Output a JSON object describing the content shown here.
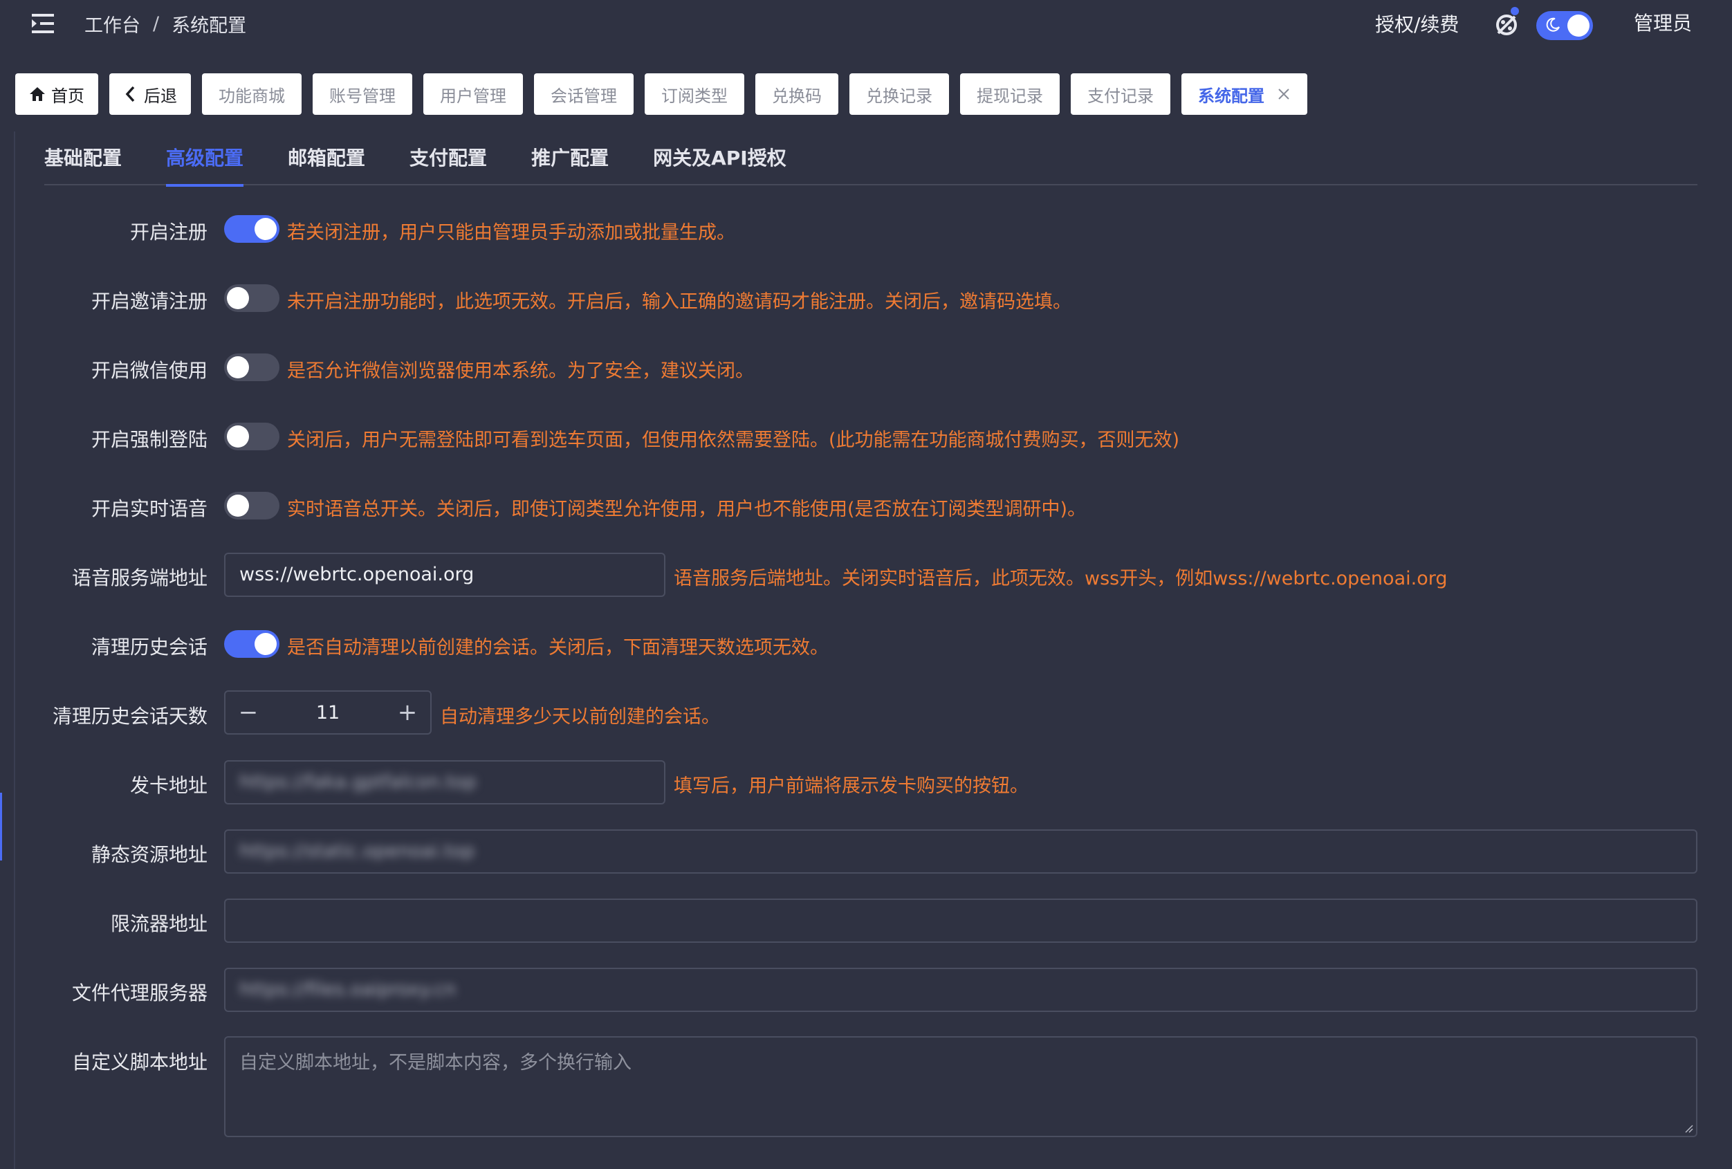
{
  "breadcrumb": {
    "root": "工作台",
    "separator": "/",
    "current": "系统配置"
  },
  "header": {
    "auth_label": "授权/续费",
    "user": "管理员"
  },
  "tags": {
    "home": "首页",
    "back": "后退",
    "items": [
      "功能商城",
      "账号管理",
      "用户管理",
      "会话管理",
      "订阅类型",
      "兑换码",
      "兑换记录",
      "提现记录",
      "支付记录"
    ],
    "active": "系统配置"
  },
  "tabs": [
    "基础配置",
    "高级配置",
    "邮箱配置",
    "支付配置",
    "推广配置",
    "网关及API授权"
  ],
  "active_tab": "高级配置",
  "form": {
    "register": {
      "label": "开启注册",
      "enabled": true,
      "hint": "若关闭注册，用户只能由管理员手动添加或批量生成。"
    },
    "invite": {
      "label": "开启邀请注册",
      "enabled": false,
      "hint": "未开启注册功能时，此选项无效。开启后，输入正确的邀请码才能注册。关闭后，邀请码选填。"
    },
    "wechat": {
      "label": "开启微信使用",
      "enabled": false,
      "hint": "是否允许微信浏览器使用本系统。为了安全，建议关闭。"
    },
    "force_login": {
      "label": "开启强制登陆",
      "enabled": false,
      "hint": "关闭后，用户无需登陆即可看到选车页面，但使用依然需要登陆。(此功能需在功能商城付费购买，否则无效)"
    },
    "realtime_voice": {
      "label": "开启实时语音",
      "enabled": false,
      "hint": "实时语音总开关。关闭后，即使订阅类型允许使用，用户也不能使用(是否放在订阅类型调研中)。"
    },
    "voice_server": {
      "label": "语音服务端地址",
      "value": "wss://webrtc.openoai.org",
      "hint": "语音服务后端地址。关闭实时语音后，此项无效。wss开头，例如wss://webrtc.openoai.org"
    },
    "clean_history": {
      "label": "清理历史会话",
      "enabled": true,
      "hint": "是否自动清理以前创建的会话。关闭后，下面清理天数选项无效。"
    },
    "clean_days": {
      "label": "清理历史会话天数",
      "value": "11",
      "hint": "自动清理多少天以前创建的会话。"
    },
    "card_url": {
      "label": "发卡地址",
      "value": "https://faka.gptfalcon.top",
      "hint": "填写后，用户前端将展示发卡购买的按钮。"
    },
    "static_url": {
      "label": "静态资源地址",
      "value": "https://static.openoai.top"
    },
    "limiter_url": {
      "label": "限流器地址",
      "value": ""
    },
    "file_proxy": {
      "label": "文件代理服务器",
      "value": "https://files.oaiproxy.cn"
    },
    "custom_script": {
      "label": "自定义脚本地址",
      "placeholder": "自定义脚本地址，不是脚本内容，多个换行输入"
    }
  },
  "colors": {
    "accent": "#4b6cf5",
    "hint": "#ef7b33",
    "background": "#2f3242"
  }
}
